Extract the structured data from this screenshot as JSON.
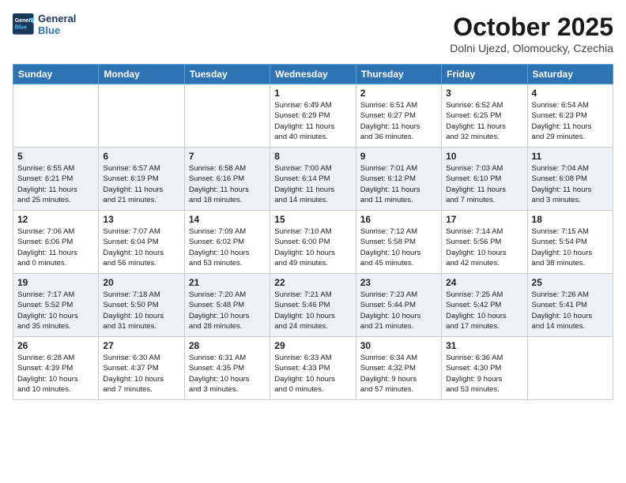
{
  "logo": {
    "line1": "General",
    "line2": "Blue"
  },
  "title": "October 2025",
  "subtitle": "Dolni Ujezd, Olomoucky, Czechia",
  "days_of_week": [
    "Sunday",
    "Monday",
    "Tuesday",
    "Wednesday",
    "Thursday",
    "Friday",
    "Saturday"
  ],
  "weeks": [
    [
      {
        "day": "",
        "info": ""
      },
      {
        "day": "",
        "info": ""
      },
      {
        "day": "",
        "info": ""
      },
      {
        "day": "1",
        "info": "Sunrise: 6:49 AM\nSunset: 6:29 PM\nDaylight: 11 hours\nand 40 minutes."
      },
      {
        "day": "2",
        "info": "Sunrise: 6:51 AM\nSunset: 6:27 PM\nDaylight: 11 hours\nand 36 minutes."
      },
      {
        "day": "3",
        "info": "Sunrise: 6:52 AM\nSunset: 6:25 PM\nDaylight: 11 hours\nand 32 minutes."
      },
      {
        "day": "4",
        "info": "Sunrise: 6:54 AM\nSunset: 6:23 PM\nDaylight: 11 hours\nand 29 minutes."
      }
    ],
    [
      {
        "day": "5",
        "info": "Sunrise: 6:55 AM\nSunset: 6:21 PM\nDaylight: 11 hours\nand 25 minutes."
      },
      {
        "day": "6",
        "info": "Sunrise: 6:57 AM\nSunset: 6:19 PM\nDaylight: 11 hours\nand 21 minutes."
      },
      {
        "day": "7",
        "info": "Sunrise: 6:58 AM\nSunset: 6:16 PM\nDaylight: 11 hours\nand 18 minutes."
      },
      {
        "day": "8",
        "info": "Sunrise: 7:00 AM\nSunset: 6:14 PM\nDaylight: 11 hours\nand 14 minutes."
      },
      {
        "day": "9",
        "info": "Sunrise: 7:01 AM\nSunset: 6:12 PM\nDaylight: 11 hours\nand 11 minutes."
      },
      {
        "day": "10",
        "info": "Sunrise: 7:03 AM\nSunset: 6:10 PM\nDaylight: 11 hours\nand 7 minutes."
      },
      {
        "day": "11",
        "info": "Sunrise: 7:04 AM\nSunset: 6:08 PM\nDaylight: 11 hours\nand 3 minutes."
      }
    ],
    [
      {
        "day": "12",
        "info": "Sunrise: 7:06 AM\nSunset: 6:06 PM\nDaylight: 11 hours\nand 0 minutes."
      },
      {
        "day": "13",
        "info": "Sunrise: 7:07 AM\nSunset: 6:04 PM\nDaylight: 10 hours\nand 56 minutes."
      },
      {
        "day": "14",
        "info": "Sunrise: 7:09 AM\nSunset: 6:02 PM\nDaylight: 10 hours\nand 53 minutes."
      },
      {
        "day": "15",
        "info": "Sunrise: 7:10 AM\nSunset: 6:00 PM\nDaylight: 10 hours\nand 49 minutes."
      },
      {
        "day": "16",
        "info": "Sunrise: 7:12 AM\nSunset: 5:58 PM\nDaylight: 10 hours\nand 45 minutes."
      },
      {
        "day": "17",
        "info": "Sunrise: 7:14 AM\nSunset: 5:56 PM\nDaylight: 10 hours\nand 42 minutes."
      },
      {
        "day": "18",
        "info": "Sunrise: 7:15 AM\nSunset: 5:54 PM\nDaylight: 10 hours\nand 38 minutes."
      }
    ],
    [
      {
        "day": "19",
        "info": "Sunrise: 7:17 AM\nSunset: 5:52 PM\nDaylight: 10 hours\nand 35 minutes."
      },
      {
        "day": "20",
        "info": "Sunrise: 7:18 AM\nSunset: 5:50 PM\nDaylight: 10 hours\nand 31 minutes."
      },
      {
        "day": "21",
        "info": "Sunrise: 7:20 AM\nSunset: 5:48 PM\nDaylight: 10 hours\nand 28 minutes."
      },
      {
        "day": "22",
        "info": "Sunrise: 7:21 AM\nSunset: 5:46 PM\nDaylight: 10 hours\nand 24 minutes."
      },
      {
        "day": "23",
        "info": "Sunrise: 7:23 AM\nSunset: 5:44 PM\nDaylight: 10 hours\nand 21 minutes."
      },
      {
        "day": "24",
        "info": "Sunrise: 7:25 AM\nSunset: 5:42 PM\nDaylight: 10 hours\nand 17 minutes."
      },
      {
        "day": "25",
        "info": "Sunrise: 7:26 AM\nSunset: 5:41 PM\nDaylight: 10 hours\nand 14 minutes."
      }
    ],
    [
      {
        "day": "26",
        "info": "Sunrise: 6:28 AM\nSunset: 4:39 PM\nDaylight: 10 hours\nand 10 minutes."
      },
      {
        "day": "27",
        "info": "Sunrise: 6:30 AM\nSunset: 4:37 PM\nDaylight: 10 hours\nand 7 minutes."
      },
      {
        "day": "28",
        "info": "Sunrise: 6:31 AM\nSunset: 4:35 PM\nDaylight: 10 hours\nand 3 minutes."
      },
      {
        "day": "29",
        "info": "Sunrise: 6:33 AM\nSunset: 4:33 PM\nDaylight: 10 hours\nand 0 minutes."
      },
      {
        "day": "30",
        "info": "Sunrise: 6:34 AM\nSunset: 4:32 PM\nDaylight: 9 hours\nand 57 minutes."
      },
      {
        "day": "31",
        "info": "Sunrise: 6:36 AM\nSunset: 4:30 PM\nDaylight: 9 hours\nand 53 minutes."
      },
      {
        "day": "",
        "info": ""
      }
    ]
  ]
}
